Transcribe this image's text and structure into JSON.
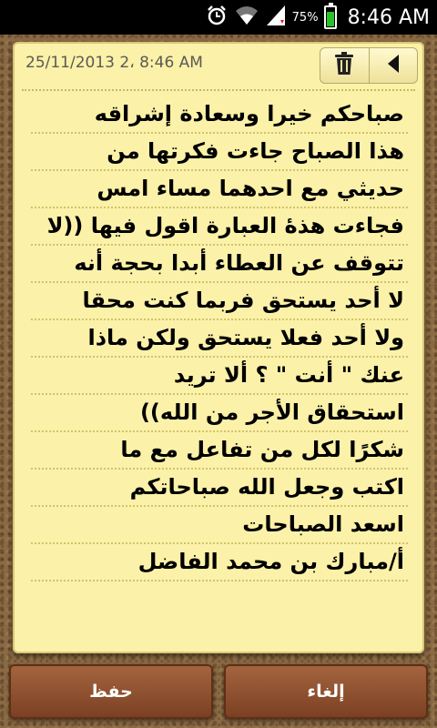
{
  "status_bar": {
    "time": "8:46 AM",
    "battery_percent": "75%",
    "battery_level": 0.75,
    "icons": [
      "alarm-icon",
      "wifi-icon",
      "signal-icon",
      "battery-icon"
    ]
  },
  "note": {
    "date": "25/11/2013 2، 8:46 AM",
    "toolbar": [
      "trash-icon",
      "back-arrow-icon"
    ],
    "lines": [
      "صباحكم خيرا وسعادة إشراقه",
      "هذا الصباح جاءت فكرتها من",
      "حديثي مع احدهما مساء امس",
      "فجاءت هذهٔ العبارة اقول فيها ((لا",
      "تتوقف عن العطاء أبدا بحجة أنه",
      "لا أحد يستحق فربما كنت محقا",
      "ولا أحد فعلا يستحق ولكن ماذا",
      "عنك \" أنت \" ؟ ألا تريد",
      "استحقاق الأجر من الله))",
      "شكرًا لكل من تفاعل مع ما",
      "اكتب وجعل الله صباحاتكم",
      "اسعد الصباحات",
      "أ/مبارك بن محمد الفاضل"
    ]
  },
  "buttons": {
    "save_label": "حفظ",
    "cancel_label": "إلغاء"
  },
  "colors": {
    "note_background": "#fbf1a8",
    "button_brown": "#8b4a2b",
    "battery_green": "#29c22b"
  }
}
